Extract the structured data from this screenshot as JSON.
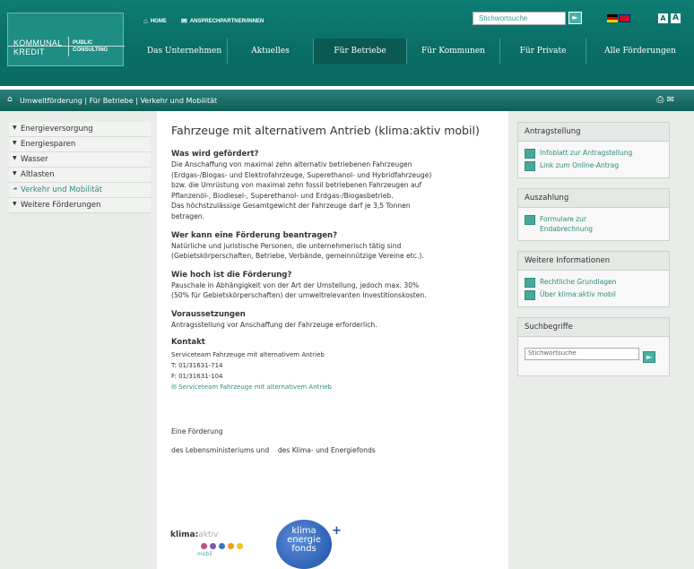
{
  "header": {
    "logo": {
      "line1": "KOMMUNAL",
      "line2": "KREDIT",
      "right1": "PUBLIC",
      "right2": "CONSULTING"
    },
    "home_label": "HOME",
    "contact_label": "ANSPRECHPARTNER/INNEN",
    "search_placeholder": "Stichwortsuche",
    "font_small": "A",
    "font_large": "A"
  },
  "nav": {
    "items": [
      {
        "label": "Das Unternehmen"
      },
      {
        "label": "Aktuelles"
      },
      {
        "label": "Für Betriebe"
      },
      {
        "label": "Für Kommunen"
      },
      {
        "label": "Für Private"
      },
      {
        "label": "Alle Förderungen"
      }
    ],
    "active_index": 2
  },
  "breadcrumb": {
    "text": "Umweltförderung | Für Betriebe | Verkehr und Mobilität"
  },
  "left_nav": {
    "items": [
      {
        "label": "Energieversorgung"
      },
      {
        "label": "Energiesparen"
      },
      {
        "label": "Wasser"
      },
      {
        "label": "Altlasten"
      },
      {
        "label": "Verkehr und Mobilität"
      },
      {
        "label": "Weitere Förderungen"
      }
    ],
    "active_index": 4
  },
  "main": {
    "title": "Fahrzeuge mit alternativem Antrieb (klima:aktiv mobil)",
    "sections": [
      {
        "heading": "Was wird gefördert?",
        "lines": [
          "Die Anschaffung von maximal zehn alternativ betriebenen Fahrzeugen",
          "(Erdgas-/Biogas- und Elektrofahrzeuge, Superethanol- und Hybridfahrzeuge)",
          "bzw. die Umrüstung von maximal zehn fossil betriebenen Fahrzeugen auf",
          "Pflanzenöl-, Biodiesel-, Superethanol- und Erdgas-/Biogasbetrieb.",
          "Das höchstzulässige Gesamtgewicht der Fahrzeuge darf je 3,5 Tonnen",
          "betragen."
        ]
      },
      {
        "heading": "Wer kann eine Förderung beantragen?",
        "lines": [
          "Natürliche und juristische Personen, die unternehmerisch tätig sind",
          "(Gebietskörperschaften, Betriebe, Verbände, gemeinnützige Vereine etc.)."
        ]
      },
      {
        "heading": "Wie hoch ist die Förderung?",
        "lines": [
          "Pauschale in Abhängigkeit von der Art der Umstellung, jedoch max. 30%",
          "(50% für Gebietskörperschaften) der umweltrelevanten Investitionskosten."
        ]
      },
      {
        "heading": "Voraussetzungen",
        "lines": [
          "Antragsstellung vor Anschaffung der Fahrzeuge erforderlich."
        ]
      }
    ],
    "contact": {
      "heading": "Kontakt",
      "team": "Serviceteam Fahrzeuge mit alternativem Antrieb",
      "phone": "T: 01/31631-714",
      "fax": "F: 01/31631-104",
      "email_label": "Serviceteam Fahrzeuge mit alternativem Antrieb"
    },
    "footer": {
      "intro": "Eine Förderung",
      "sponsors": "des Lebensministeriums und    des Klima- und Energiefonds",
      "klimaaktiv_bold": "klima:",
      "klimaaktiv_light": "aktiv",
      "klimaaktiv_mobil": "mobil",
      "kef_line1": "klima",
      "kef_line2": "energie",
      "kef_line3": "fonds",
      "kef_plus": "+"
    }
  },
  "sidebar": {
    "boxes": [
      {
        "title": "Antragstellung",
        "links": [
          "Infoblatt zur Antragstellung",
          "Link zum Online-Antrag"
        ]
      },
      {
        "title": "Auszahlung",
        "links": [
          "Formulare zur Endabrechnung"
        ]
      },
      {
        "title": "Weitere Informationen",
        "links": [
          "Rechtliche Grundlagen",
          "Über klima:aktiv mobil"
        ]
      }
    ],
    "search": {
      "title": "Suchbegriffe",
      "placeholder": "Stichwortsuche"
    }
  },
  "colors": {
    "brand": "#0a6e66",
    "accent": "#2e8c80",
    "background": "#e9ece9"
  }
}
